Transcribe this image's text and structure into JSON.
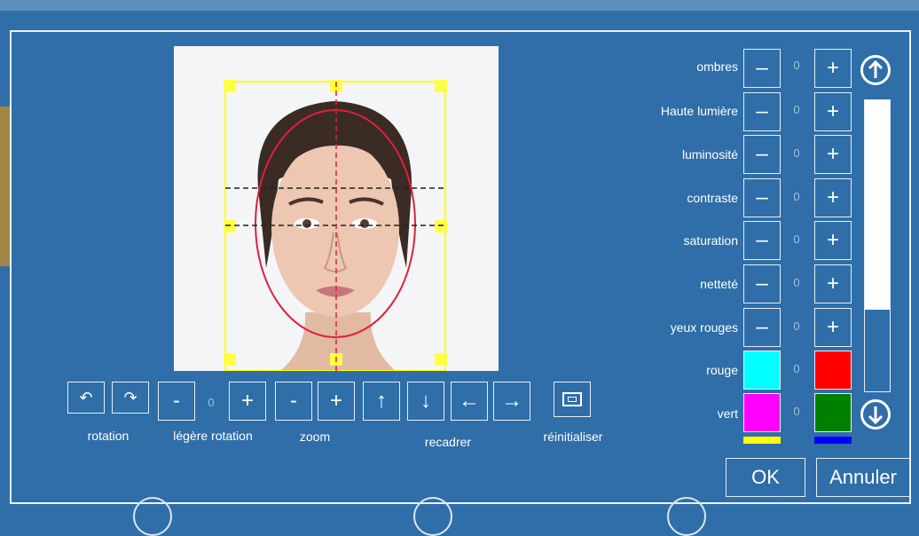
{
  "toolbar": {
    "rotation_label": "rotation",
    "slight_rotation_label": "légère rotation",
    "slight_rotation_value": "0",
    "zoom_label": "zoom",
    "recrop_label": "recadrer",
    "reset_label": "réinitialiser",
    "minus": "-",
    "plus": "+",
    "up_arrow": "↑",
    "down_arrow": "↓",
    "left_arrow": "←",
    "right_arrow": "→"
  },
  "adjustments": [
    {
      "label": "ombres",
      "value": "0"
    },
    {
      "label": "Haute lumière",
      "value": "0"
    },
    {
      "label": "luminosité",
      "value": "0"
    },
    {
      "label": "contraste",
      "value": "0"
    },
    {
      "label": "saturation",
      "value": "0"
    },
    {
      "label": "netteté",
      "value": "0"
    },
    {
      "label": "yeux rouges",
      "value": "0"
    }
  ],
  "adjust_minus": "–",
  "adjust_plus": "+",
  "colors": [
    {
      "label": "rouge",
      "value": "0",
      "left_color": "#00ffff",
      "right_color": "#ff0000"
    },
    {
      "label": "vert",
      "value": "0",
      "left_color": "#ff00ff",
      "right_color": "#008000"
    }
  ],
  "next_color_bars": {
    "left_color": "#ffff00",
    "right_color": "#0000ff"
  },
  "scrollbar": {
    "position_fraction": 0.0,
    "visible_fraction": 0.72
  },
  "buttons": {
    "ok": "OK",
    "cancel": "Annuler"
  },
  "theme": {
    "background": "#2f6ea8",
    "crop_frame": "#ffff00",
    "face_oval": "#e0203a"
  }
}
